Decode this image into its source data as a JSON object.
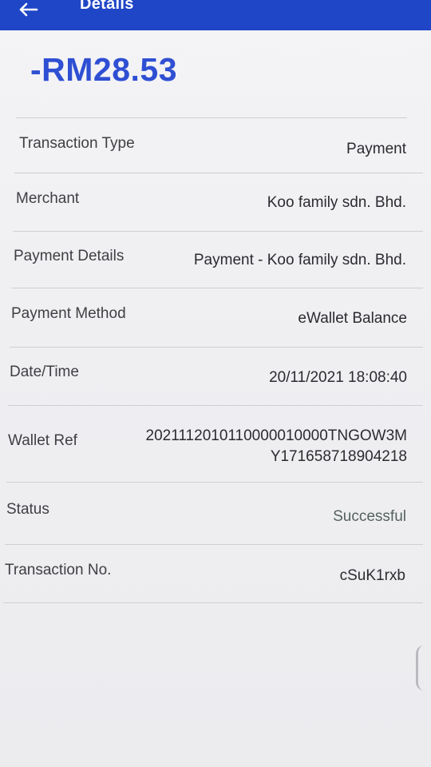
{
  "header": {
    "title": "Details",
    "back_icon": "arrow-left-icon",
    "bar_color": "#1f46c6"
  },
  "amount": {
    "text": "-RM28.53",
    "color": "#2f4fd3"
  },
  "details": [
    {
      "label": "Transaction Type",
      "value": "Payment"
    },
    {
      "label": "Merchant",
      "value": "Koo family sdn. Bhd."
    },
    {
      "label": "Payment Details",
      "value": "Payment - Koo family sdn. Bhd."
    },
    {
      "label": "Payment Method",
      "value": "eWallet Balance"
    },
    {
      "label": "Date/Time",
      "value": "20/11/2021 18:08:40"
    },
    {
      "label": "Wallet Ref",
      "value_line1": "20211120101100000100​00TNGOW3M",
      "value_line2": "Y171658718904218"
    },
    {
      "label": "Status",
      "value": "Successful"
    },
    {
      "label": "Transaction No.",
      "value": "cSuK1rxb"
    }
  ]
}
